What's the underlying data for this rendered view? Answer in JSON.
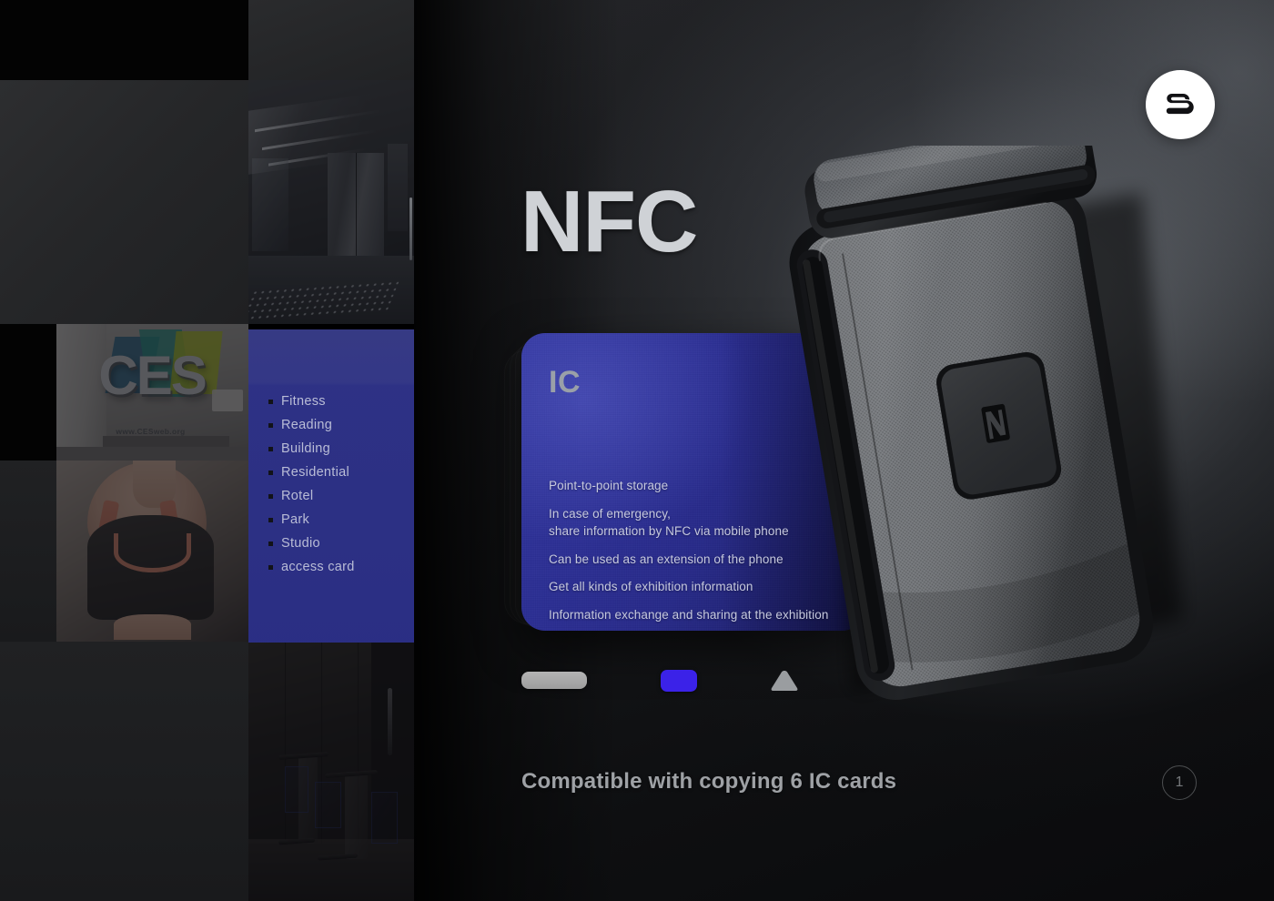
{
  "brand": {
    "logo_icon": "s-clip-logo-icon"
  },
  "hero": {
    "title": "NFC",
    "caption": "Compatible with copying 6 IC cards",
    "page_number": "1"
  },
  "ic_card": {
    "label": "IC",
    "lines": [
      "Point-to-point storage",
      "In case of emergency,",
      "share information by NFC via mobile phone",
      "Can be used as an extension of the phone",
      "Get all kinds of exhibition information",
      "Information exchange and sharing at the exhibition"
    ]
  },
  "swatches": [
    {
      "name": "gray-bar-swatch",
      "color": "#a8a8a8",
      "shape": "rounded-bar"
    },
    {
      "name": "blue-swatch",
      "color": "#3b22e8",
      "shape": "rounded-rect"
    },
    {
      "name": "gray-triangle-swatch",
      "color": "#9a9da0",
      "shape": "triangle"
    }
  ],
  "list_panel": {
    "items": [
      {
        "label": "Fitness"
      },
      {
        "label": "Reading"
      },
      {
        "label": "Building"
      },
      {
        "label": "Residential"
      },
      {
        "label": "Rotel"
      },
      {
        "label": "Park"
      },
      {
        "label": "Studio"
      },
      {
        "label": "access card"
      }
    ]
  },
  "mosaic": {
    "ces_photo": {
      "sign_text": "CES",
      "url_text": "www.CESweb.org"
    },
    "lobby_photo": {
      "alt": "elevator lobby"
    },
    "fitness_photo": {
      "alt": "woman in sports bra"
    },
    "gate_photo": {
      "alt": "access control turnstile gates"
    }
  },
  "device": {
    "nfc_pad_icon": "nfc-n-icon",
    "body_color": "#6d7074",
    "rim_color": "#141416"
  },
  "colors": {
    "card_blue": "#2c2f93",
    "panel_blue": "#3c4090",
    "accent_blue": "#3b22e8",
    "title_gray": "#cfd2d6",
    "caption_gray": "#9ea1a5"
  }
}
